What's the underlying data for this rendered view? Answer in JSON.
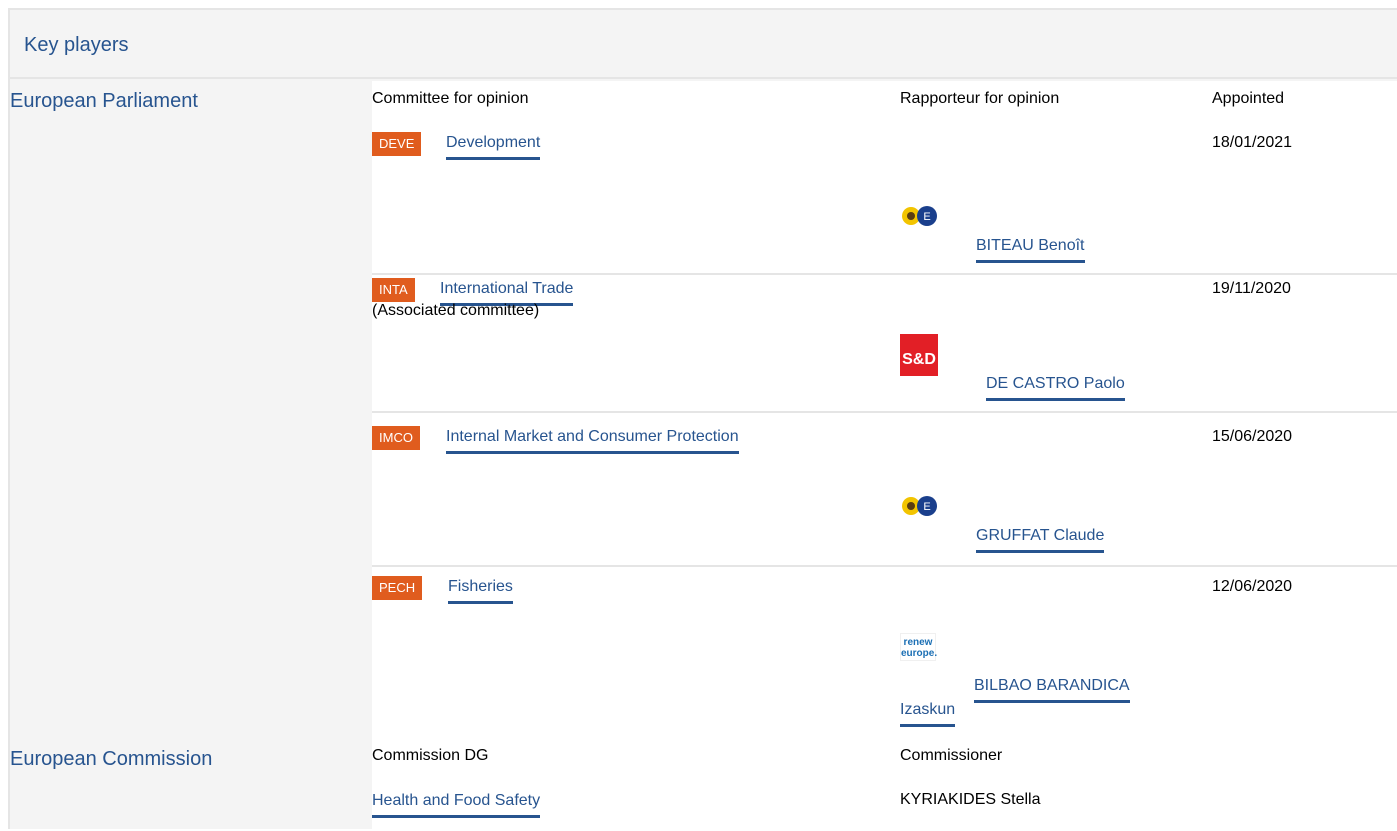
{
  "header": {
    "title": "Key players"
  },
  "ep": {
    "name": "European Parliament",
    "col_committee": "Committee for opinion",
    "col_rapporteur": "Rapporteur for opinion",
    "col_appointed": "Appointed",
    "rows": [
      {
        "abbr": "DEVE",
        "committee": "Development",
        "note": "",
        "rapporteur": "BITEAU Benoît",
        "group_logo": "greens-efa-logo",
        "date": "18/01/2021"
      },
      {
        "abbr": "INTA",
        "committee": "International Trade",
        "note": "(Associated committee)",
        "rapporteur": "DE CASTRO Paolo",
        "group_logo": "s-and-d-logo",
        "group_logo_text": "S&D",
        "date": "19/11/2020"
      },
      {
        "abbr": "IMCO",
        "committee": "Internal Market and Consumer Protection",
        "note": "",
        "rapporteur": "GRUFFAT Claude",
        "group_logo": "greens-efa-logo",
        "date": "15/06/2020"
      },
      {
        "abbr": "PECH",
        "committee": "Fisheries",
        "note": "",
        "rapporteur_line1": "BILBAO BARANDICA",
        "rapporteur_line2": "Izaskun",
        "group_logo": "renew-europe-logo",
        "group_logo_text_1": "renew",
        "group_logo_text_2": "europe.",
        "date": "12/06/2020"
      }
    ]
  },
  "ec": {
    "name": "European Commission",
    "col_dg": "Commission DG",
    "col_commissioner": "Commissioner",
    "dg": "Health and Food Safety",
    "commissioner": "KYRIAKIDES Stella"
  },
  "colors": {
    "link": "#27548f",
    "badge": "#e05c1e",
    "border": "#e5e5e5",
    "panel_bg": "#f4f4f4"
  }
}
